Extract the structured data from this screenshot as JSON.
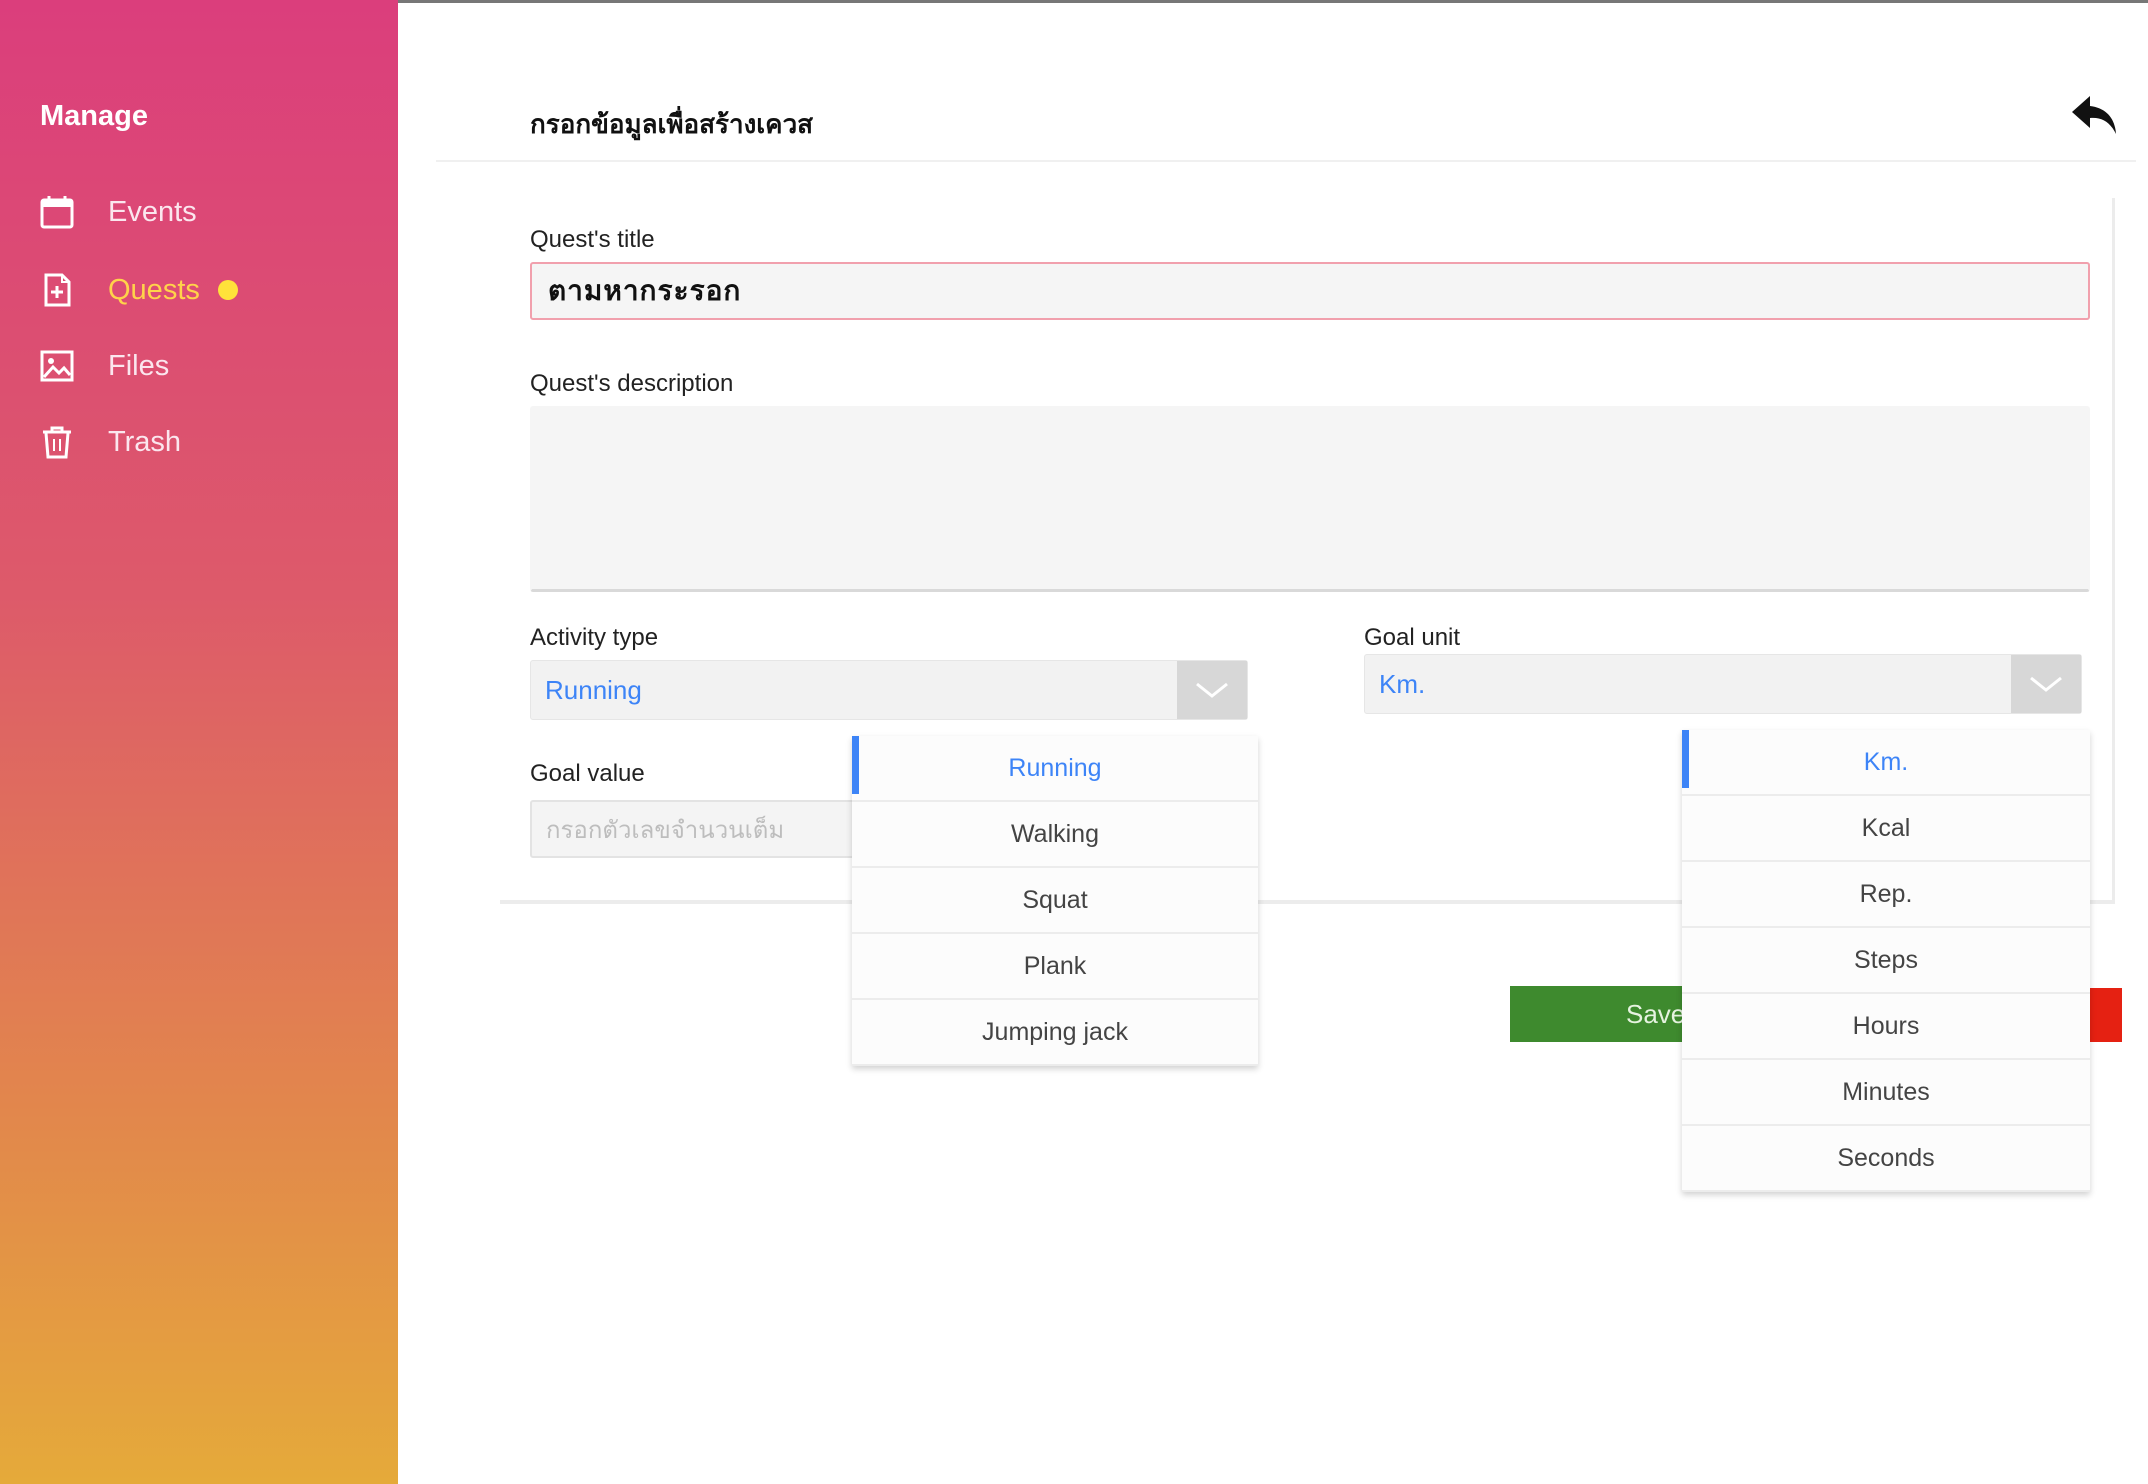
{
  "sidebar": {
    "heading": "Manage",
    "items": [
      {
        "label": "Events",
        "icon": "calendar-icon"
      },
      {
        "label": "Quests",
        "icon": "document-icon",
        "active": true,
        "badge_color": "#ffe23a"
      },
      {
        "label": "Files",
        "icon": "image-icon"
      },
      {
        "label": "Trash",
        "icon": "trash-icon"
      }
    ]
  },
  "header": {
    "title": "กรอกข้อมูลเพื่อสร้างเควส",
    "back_icon": "back-arrow-icon"
  },
  "form": {
    "title_label": "Quest's title",
    "title_value": "ตามหากระรอก",
    "description_label": "Quest's description",
    "description_value": "",
    "activity_label": "Activity type",
    "activity_value": "Running",
    "goal_unit_label": "Goal unit",
    "goal_unit_value": "Km.",
    "goal_value_label": "Goal value",
    "goal_value_placeholder": "กรอกตัวเลขจำนวนเต็ม"
  },
  "activity_options": [
    "Running",
    "Walking",
    "Squat",
    "Plank",
    "Jumping jack"
  ],
  "unit_options": [
    "Km.",
    "Kcal",
    "Rep.",
    "Steps",
    "Hours",
    "Minutes",
    "Seconds"
  ],
  "buttons": {
    "save_label": "Save"
  },
  "colors": {
    "accent": "#3d84f7",
    "save": "#3e8a2e",
    "cancel": "#e52112",
    "sidebar_top": "#db3e7c",
    "sidebar_bottom": "#e5aa3a"
  }
}
